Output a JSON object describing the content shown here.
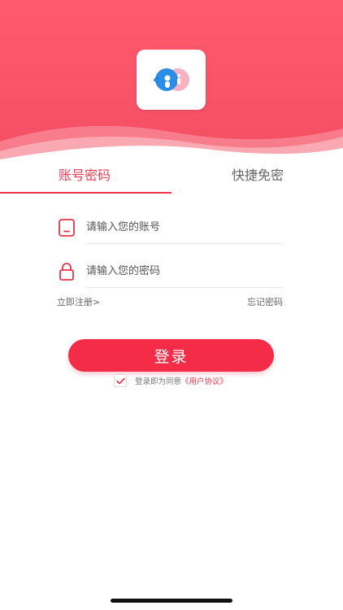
{
  "header": {
    "brand_color": "#f44e63",
    "logo_icon": "app-logo-icon"
  },
  "tabs": [
    {
      "label": "账号密码",
      "active": true
    },
    {
      "label": "快捷免密",
      "active": false
    }
  ],
  "form": {
    "account": {
      "placeholder": "请输入您的账号",
      "value": "",
      "icon": "phone-icon"
    },
    "password": {
      "placeholder": "请输入您的密码",
      "value": "",
      "icon": "lock-icon"
    }
  },
  "links": {
    "register": "立即注册>",
    "forgot": "忘记密码"
  },
  "login_button": {
    "label": "登录",
    "color": "#f42c47"
  },
  "agreement": {
    "checked": true,
    "text": "登录即为同意",
    "link": "《用户协议》"
  }
}
